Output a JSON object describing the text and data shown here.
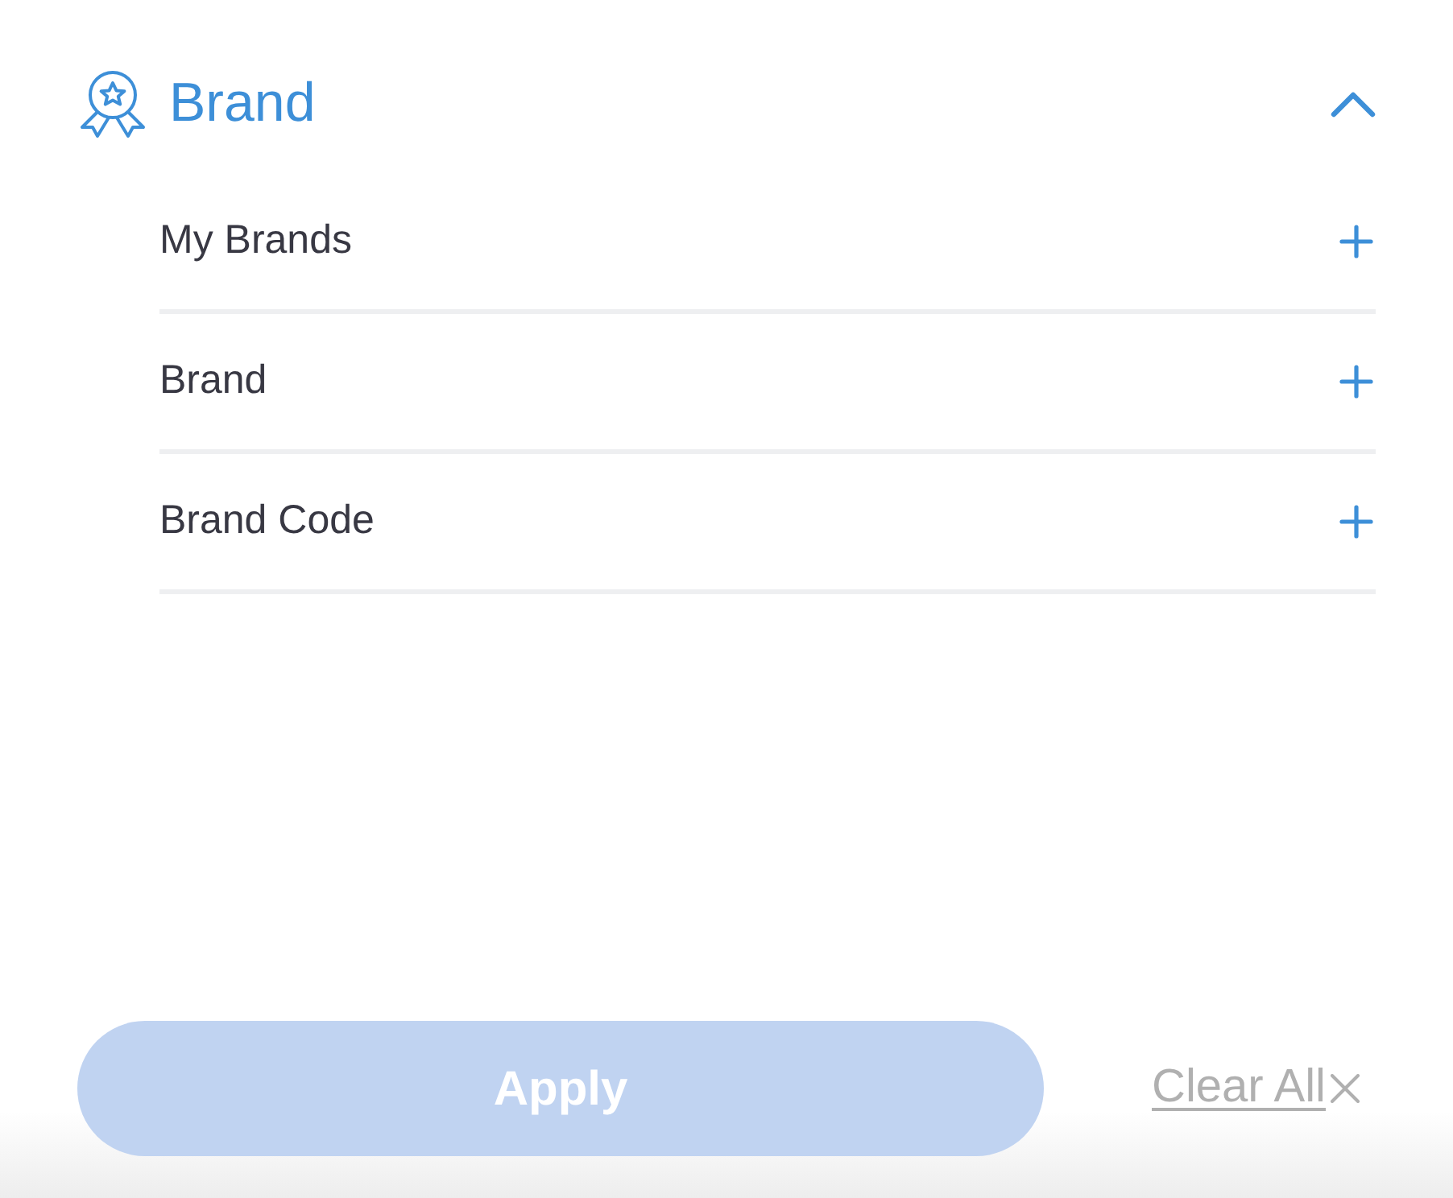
{
  "section": {
    "title": "Brand",
    "expanded": true
  },
  "filters": [
    {
      "label": "My Brands",
      "expanded": false
    },
    {
      "label": "Brand",
      "expanded": false
    },
    {
      "label": "Brand Code",
      "expanded": false
    }
  ],
  "apply_button": {
    "label": "Apply",
    "disabled": true
  },
  "clear_all": {
    "label": "Clear All"
  }
}
